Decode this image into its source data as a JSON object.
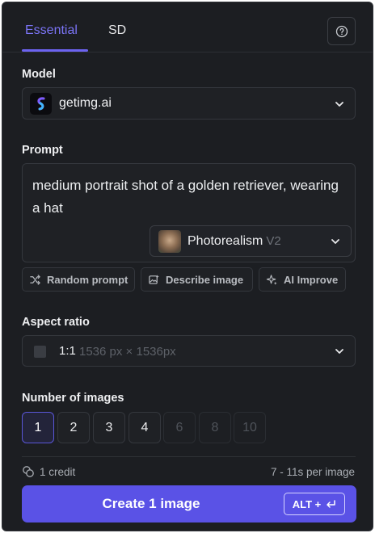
{
  "tabs": [
    {
      "label": "Essential",
      "active": true
    },
    {
      "label": "SD",
      "active": false
    }
  ],
  "model": {
    "label": "Model",
    "value": "getimg.ai"
  },
  "prompt": {
    "label": "Prompt",
    "text": "medium portrait shot of a golden retriever, wearing a hat",
    "style": {
      "name": "Photorealism",
      "version": "V2"
    }
  },
  "actions": {
    "random": "Random prompt",
    "describe": "Describe image",
    "improve": "AI Improve"
  },
  "aspect": {
    "label": "Aspect ratio",
    "ratio": "1:1",
    "dimensions": "1536 px × 1536px"
  },
  "images": {
    "label": "Number of images",
    "options": [
      "1",
      "2",
      "3",
      "4",
      "6",
      "8",
      "10"
    ],
    "selected": "1"
  },
  "footer": {
    "credit": "1 credit",
    "time": "7 - 11s per image"
  },
  "create": {
    "label": "Create 1 image",
    "shortcut": "ALT +"
  },
  "colors": {
    "accent": "#5a52e6",
    "background": "#1c1e22",
    "tab_active": "#7b74f6"
  }
}
